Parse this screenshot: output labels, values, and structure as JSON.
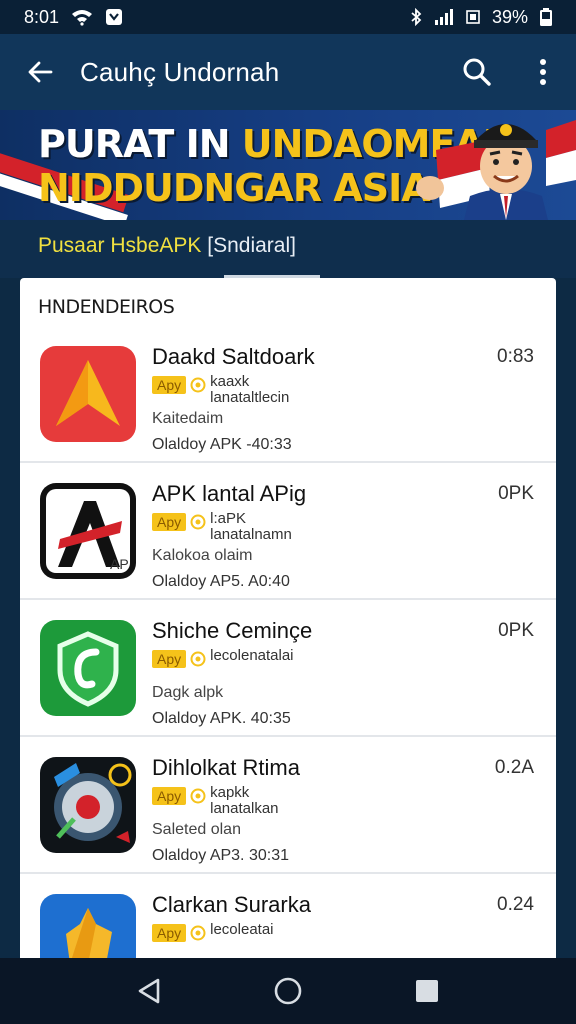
{
  "status": {
    "time": "8:01",
    "battery": "39%"
  },
  "app_bar": {
    "title": "Cauhç Undornah"
  },
  "banner": {
    "line1_white": "PURAT IN ",
    "line1_yellow": "UNDAOMEAN",
    "line2": "NIDDUDNGAR ASIA"
  },
  "subheader": {
    "label_main": "Pusaar HsbeAPK ",
    "label_paren": "[Sndiaral]"
  },
  "list": {
    "section_title": "HNDENDEIROS",
    "items": [
      {
        "name": "Daakd Saltdoark",
        "size": "0:83",
        "tag": "Apy",
        "tag_text": "kaaxk\nlanataltlecin",
        "desc": "Kaitedaim",
        "meta": "Olaldoy APK  -40:33",
        "icon": "red-arrow-icon"
      },
      {
        "name": "APK lantal APig",
        "size": "0PK",
        "tag": "Apy",
        "tag_text": "l:aPK\nlanatalnamn",
        "desc": "Kalokoa olaim",
        "meta": "Olaldoy AP5.  A0:40",
        "icon": "letter-a-icon"
      },
      {
        "name": "Shiche Ceminçe",
        "size": "0PK",
        "tag": "Apy",
        "tag_text": "lecolenatalai",
        "desc": "Dagk alpk",
        "meta": "Olaldoy APK.  40:35",
        "icon": "green-shield-icon"
      },
      {
        "name": "Dihlolkat Rtima",
        "size": "0.2A",
        "tag": "Apy",
        "tag_text": "kapkk\nlanatalkan",
        "desc": "Saleted olan",
        "meta": "Olaldoy AP3.  30:31",
        "icon": "disc-icon"
      },
      {
        "name": "Clarkan Surarka",
        "size": "0.24",
        "tag": "Apy",
        "tag_text": "lecoleatai",
        "desc": "",
        "meta": "",
        "icon": "blue-gold-icon"
      }
    ]
  },
  "colors": {
    "accent_yellow": "#f5c21a",
    "app_bar": "#11365a",
    "background": "#0d2a44"
  }
}
